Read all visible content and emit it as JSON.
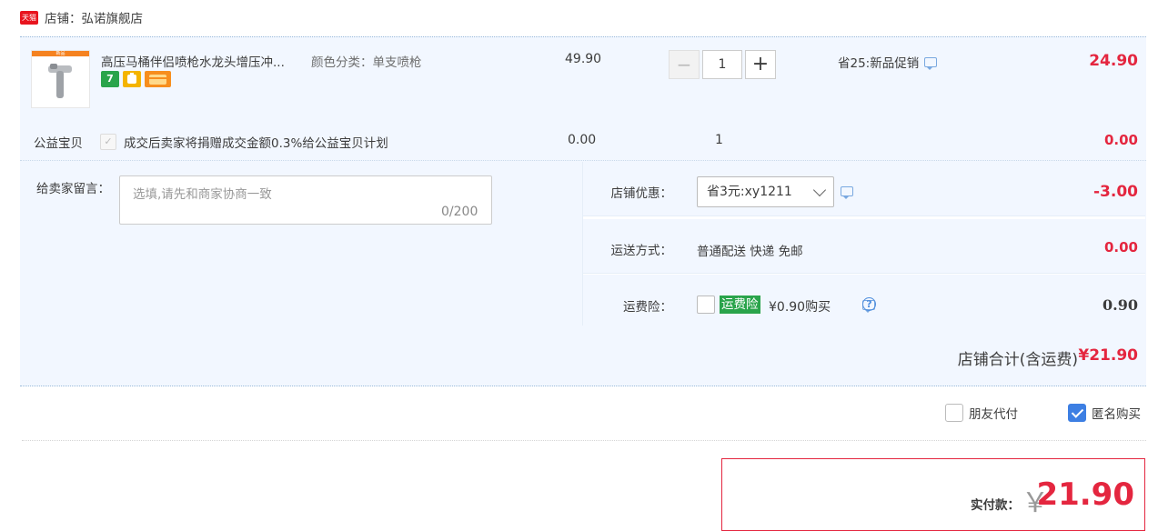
{
  "shop": {
    "badge": "天猫",
    "name": "店铺：弘诺旗舰店"
  },
  "item": {
    "thumb_banner": "新品",
    "name": "高压马桶伴侣喷枪水龙头增压冲...",
    "sku": "颜色分类：单支喷枪",
    "tags": [
      "7",
      "",
      ""
    ],
    "unit_price": "49.90",
    "quantity": "1",
    "promo": "省25:新品促销",
    "total": "24.90"
  },
  "charity": {
    "label": "公益宝贝",
    "text": "成交后卖家将捐赠成交金额0.3%给公益宝贝计划",
    "price": "0.00",
    "qty": "1",
    "total": "0.00"
  },
  "message": {
    "label": "给卖家留言：",
    "placeholder": "选填,请先和商家协商一致",
    "counter": "0/200"
  },
  "coupon": {
    "label": "店铺优惠：",
    "selected": "省3元:xy1211",
    "value": "-3.00"
  },
  "shipping": {
    "label": "运送方式：",
    "method": "普通配送 快递 免邮",
    "value": "0.00"
  },
  "insurance": {
    "label": "运费险：",
    "badge": "运费险",
    "price": "¥0.90购买",
    "value": "0.90"
  },
  "shop_total": {
    "label": "店铺合计(含运费)",
    "value": "¥21.90"
  },
  "options": {
    "friend_pay": "朋友代付",
    "anonymous": "匿名购买",
    "anonymous_checked": true
  },
  "payment": {
    "label": "实付款：",
    "currency": "￥",
    "value": "21.90"
  },
  "colors": {
    "price_red": "#e4263f",
    "panel_bg": "#f2f7ff",
    "checkbox_blue": "#3d7fe3",
    "insurance_green": "#2aa44b"
  }
}
